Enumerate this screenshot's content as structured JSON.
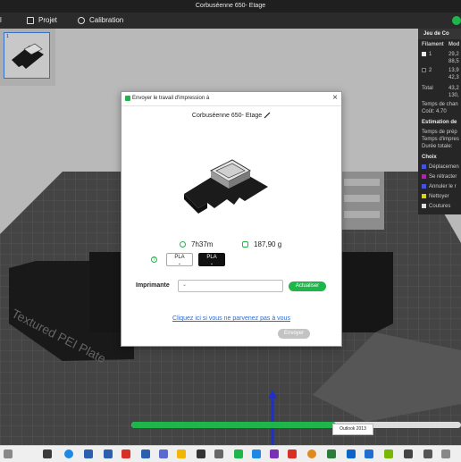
{
  "window": {
    "title": "Corbuséenne 650- Etage"
  },
  "menu": {
    "items": [
      {
        "label": "l",
        "icon": "menu-icon"
      },
      {
        "label": "Projet",
        "icon": "project-icon"
      },
      {
        "label": "Calibration",
        "icon": "calibration-icon"
      }
    ]
  },
  "plate": {
    "thumbnail_number": "1",
    "bed_text": "Textured PEI Plate"
  },
  "side_panel": {
    "header": "Jeu de Co",
    "col_filament": "Filament",
    "col_mod": "Mod",
    "rows": [
      {
        "id": "1",
        "v1": "29,2",
        "v2": "88,5",
        "color": "#ffffff"
      },
      {
        "id": "2",
        "v1": "13,9",
        "v2": "42,3",
        "color": "#222222"
      }
    ],
    "total_label": "Total",
    "total_v1": "43,2",
    "total_v2": "130,",
    "change_time": "Temps de chan",
    "cost": "Coût:  4.70",
    "estimation": "Estimation de",
    "prep_time": "Temps de prép",
    "print_time": "Temps d'impres",
    "total_time": "Durée totale:",
    "choix": "Choix",
    "legend": [
      {
        "label": "Déplacemen",
        "color": "#4b5be8"
      },
      {
        "label": "Se rétracter",
        "color": "#c425c4"
      },
      {
        "label": "Annuler le r",
        "color": "#4b5be8"
      },
      {
        "label": "Nettoyer",
        "color": "#e8e820"
      },
      {
        "label": "Coutures",
        "color": "#f2f2f2"
      }
    ]
  },
  "dialog": {
    "title": "Envoyer le travail d'impression à",
    "close": "×",
    "printer_name": "Corbuséenne 650- Etage",
    "time": "7h37m",
    "weight": "187,90 g",
    "help": "?",
    "filaments": [
      {
        "label": "PLA",
        "style": "light"
      },
      {
        "label": "PLA",
        "style": "dark"
      }
    ],
    "printer_label": "Imprimante",
    "refresh_button": "Actualiser",
    "help_link": "Cliquez ici si vous ne parvenez pas à vous",
    "send_button": "Envoyer"
  },
  "tooltip": "Outlook 2013",
  "progress": {
    "fraction": 0.62
  },
  "colors": {
    "accent": "#1eb54a",
    "link": "#2a6ad8"
  }
}
